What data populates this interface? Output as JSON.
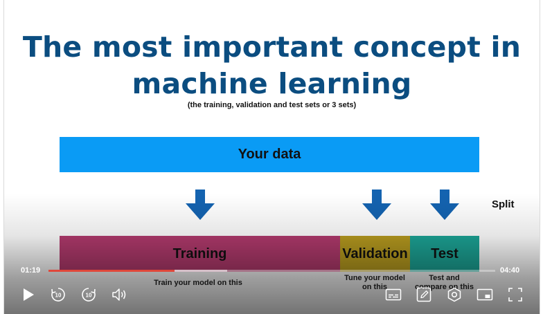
{
  "slide": {
    "title_line1": "The most important concept in",
    "title_line2": "machine learning",
    "subtitle": "(the training, validation and test sets or 3 sets)",
    "your_data_label": "Your data",
    "split_label": "Split",
    "bars": {
      "training": "Training",
      "validation": "Validation",
      "test": "Test"
    },
    "captions": {
      "training": "Train your model on this",
      "validation_line1": "Tune your model",
      "validation_line2": "on this",
      "test_line1": "Test and",
      "test_line2": "compare on this"
    },
    "colors": {
      "title": "#0b4d80",
      "your_data": "#0a9bf5",
      "arrow": "#1463b0",
      "training": "#b23a6d",
      "validation": "#b79b1f",
      "test": "#1ca496"
    }
  },
  "player": {
    "current_time": "01:19",
    "duration": "04:40",
    "progress_fraction": 0.282,
    "buffered_fraction": 0.4,
    "controls": {
      "play_icon": "play-icon",
      "rewind_icon": "rewind-10-icon",
      "rewind_label": "10",
      "forward_icon": "forward-10-icon",
      "forward_label": "10",
      "volume_icon": "volume-icon",
      "captions_icon": "captions-icon",
      "notes_icon": "pencil-note-icon",
      "settings_icon": "settings-gear-icon",
      "pip_icon": "picture-in-picture-icon",
      "fullscreen_icon": "fullscreen-icon"
    }
  }
}
